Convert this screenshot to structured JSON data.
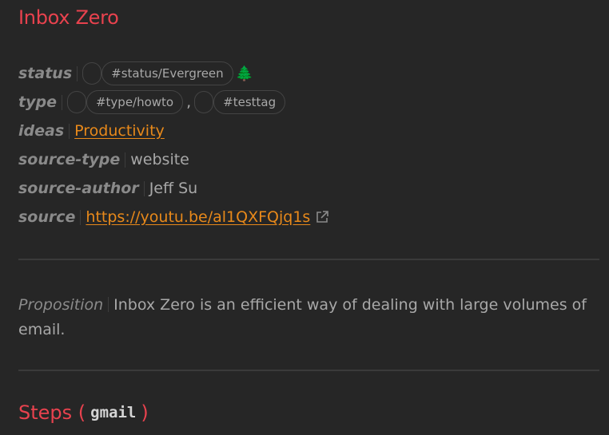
{
  "note": {
    "title": "Inbox Zero"
  },
  "properties": {
    "status": {
      "key": "status",
      "tag": "#status/Evergreen",
      "emoji": "🌲"
    },
    "type": {
      "key": "type",
      "tags": [
        "#type/howto",
        "#testtag"
      ],
      "separator": ","
    },
    "ideas": {
      "key": "ideas",
      "link": "Productivity"
    },
    "source_type": {
      "key": "source-type",
      "value": "website"
    },
    "source_author": {
      "key": "source-author",
      "value": "Jeff Su"
    },
    "source": {
      "key": "source",
      "url": "https://youtu.be/al1QXFQjq1s",
      "icon": "external-link-icon"
    }
  },
  "proposition": {
    "key": "Proposition",
    "text": "Inbox Zero is an efficient way of dealing with large volumes of email."
  },
  "steps_heading": {
    "prefix": "Steps (",
    "code": "gmail",
    "suffix": ")"
  },
  "colors": {
    "background": "#262626",
    "heading": "#e8424e",
    "link": "#e8891a",
    "text": "#a8a8a8",
    "key": "#8a8a8a"
  }
}
